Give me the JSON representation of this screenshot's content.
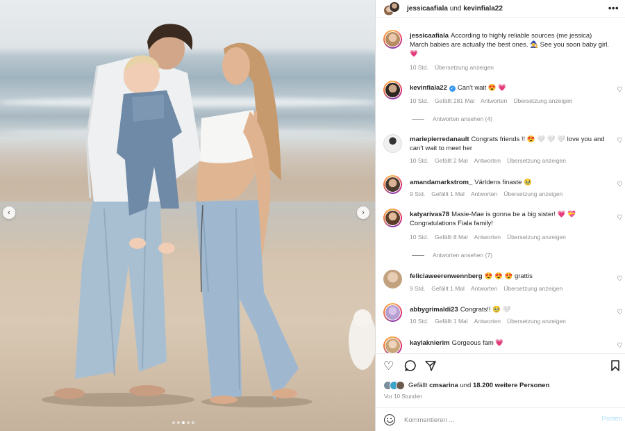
{
  "post": {
    "image_alt": "Familienfoto am Strand",
    "carousel_dots": 5,
    "carousel_active": 2
  },
  "header": {
    "user1": "jessicaafiala",
    "joiner": "und",
    "user2": "kevinfiala22",
    "more_icon": "more-horizontal-icon"
  },
  "caption": {
    "username": "jessicaafiala",
    "text": "According to highly reliable sources (me jessica) March babies are actually the best ones. 🧙‍♀️ See you soon baby girl. 💗",
    "time": "10 Std.",
    "translate": "Übersetzung anzeigen"
  },
  "comments": [
    {
      "username": "kevinfiala22",
      "verified": true,
      "text": "Can't wait 😍 💗",
      "time": "10 Std.",
      "likes": "Gefällt 281 Mal",
      "reply": "Antworten",
      "translate": "Übersetzung anzeigen",
      "view_replies": "Antworten ansehen (4)"
    },
    {
      "username": "mariepierredanault",
      "text": "Congrats friends !! 😍 🤍 🤍 🤍 love you and can't wait to meet her",
      "time": "10 Std.",
      "likes": "Gefällt 2 Mal",
      "reply": "Antworten",
      "translate": "Übersetzung anzeigen"
    },
    {
      "username": "amandamarkstrom_",
      "text": "Världens finaste 🥹",
      "time": "9 Std.",
      "likes": "Gefällt 1 Mal",
      "reply": "Antworten",
      "translate": "Übersetzung anzeigen"
    },
    {
      "username": "katyarivas78",
      "text": "Masie-Mae is gonna be a big sister! 💗 💝 Congratulations Fiala family!",
      "time": "10 Std.",
      "likes": "Gefällt 8 Mal",
      "reply": "Antworten",
      "translate": "Übersetzung anzeigen",
      "view_replies": "Antworten ansehen (7)"
    },
    {
      "username": "feliciaweerenwennberg",
      "text": "😍 😍 😍 grattis",
      "time": "9 Std.",
      "likes": "Gefällt 1 Mal",
      "reply": "Antworten",
      "translate": "Übersetzung anzeigen"
    },
    {
      "username": "abbygrimaldi23",
      "text": "Congrats!! 🥹 🤍",
      "time": "10 Std.",
      "likes": "Gefällt 1 Mal",
      "reply": "Antworten",
      "translate": "Übersetzung anzeigen"
    },
    {
      "username": "kaylaknierim",
      "text": "Gorgeous fam 💗"
    }
  ],
  "actions": {
    "like_icon": "heart-icon",
    "comment_icon": "comment-icon",
    "share_icon": "send-icon",
    "save_icon": "bookmark-icon"
  },
  "likes": {
    "prefix": "Gefällt",
    "user": "cmsarina",
    "joiner": "und",
    "others": "18.200 weitere Personen"
  },
  "post_time": "Vor 10 Stunden",
  "add_comment": {
    "placeholder": "Kommentieren ...",
    "post_label": "Posten",
    "post_color": "#b2dffc"
  },
  "colors": {
    "text": "#262626",
    "secondary": "#8e8e8e",
    "verified": "#3897f0",
    "link": "#0095f6"
  }
}
